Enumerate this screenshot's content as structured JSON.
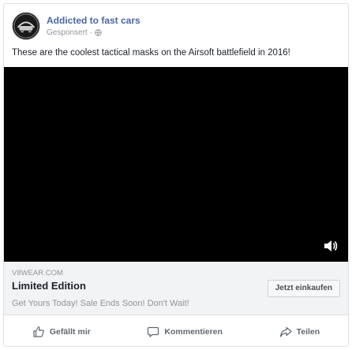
{
  "post": {
    "page_name": "Addicted to fast cars",
    "sponsored_label": "Gesponsert",
    "separator": "·",
    "caption": "These are the coolest tactical masks on the Airsoft battlefield in 2016!"
  },
  "link": {
    "domain": "V8WEAR.COM",
    "headline": "Limited Edition",
    "description": "Get Yours Today! Sale Ends Soon! Don't Wait!",
    "cta_label": "Jetzt einkaufen"
  },
  "actions": {
    "like_label": "Gefällt mir",
    "comment_label": "Kommentieren",
    "share_label": "Teilen"
  },
  "icons": {
    "avatar": "brand-logo",
    "privacy": "globe-icon",
    "volume": "speaker-icon",
    "like": "thumbs-up-icon",
    "comment": "comment-bubble-icon",
    "share": "share-arrow-icon"
  },
  "colors": {
    "page_name": "#4b67a1",
    "video_bg": "#000000",
    "link_box_bg": "#f2f3f5"
  }
}
